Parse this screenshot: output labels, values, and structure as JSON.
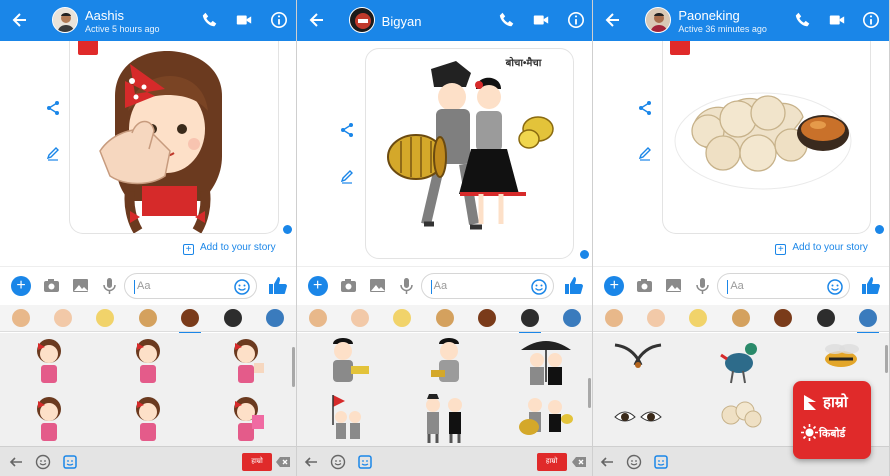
{
  "panels": [
    {
      "header": {
        "name": "Aashis",
        "status": "Active 5 hours ago"
      },
      "story_label": "Add to your story",
      "composer_placeholder": "Aa"
    },
    {
      "header": {
        "name": "Bigyan",
        "status": ""
      },
      "sticker_caption": "बोचा•मैचा",
      "composer_placeholder": "Aa"
    },
    {
      "header": {
        "name": "Paoneking",
        "status": "Active 36 minutes ago"
      },
      "story_label": "Add to your story",
      "composer_placeholder": "Aa"
    }
  ],
  "keyboard_brand_badge": "हाम्रो",
  "logo": {
    "line1": "हाम्रो",
    "line2": "किबोर्ड"
  },
  "colors": {
    "messenger_blue": "#1a86e8",
    "brand_red": "#e02a2a",
    "panel_bg": "#ffffff",
    "keyboard_bg": "#f0f0f0"
  },
  "icons": [
    "back-arrow-icon",
    "phone-icon",
    "video-icon",
    "info-icon",
    "share-icon",
    "edit-icon",
    "plus-icon",
    "camera-icon",
    "image-icon",
    "mic-icon",
    "emoji-icon",
    "like-icon",
    "keyboard-back-icon",
    "smiley-icon",
    "sticker-icon",
    "delete-icon"
  ]
}
